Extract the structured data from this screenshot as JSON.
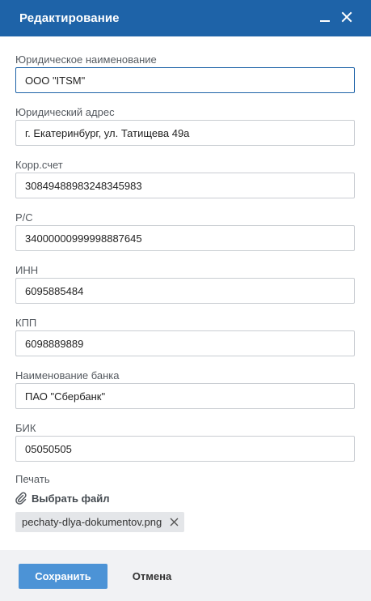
{
  "header": {
    "title": "Редактирование",
    "minimize_icon": "minimize-icon",
    "close_icon": "close-icon"
  },
  "form": {
    "fields": [
      {
        "label": "Юридическое наименование",
        "value": "ООО \"ITSM\""
      },
      {
        "label": "Юридический адрес",
        "value": "г. Екатеринбург, ул. Татищева 49а"
      },
      {
        "label": "Корр.счет",
        "value": "30849488983248345983"
      },
      {
        "label": "Р/С",
        "value": "34000000999998887645"
      },
      {
        "label": "ИНН",
        "value": "6095885484"
      },
      {
        "label": "КПП",
        "value": "6098889889"
      },
      {
        "label": "Наименование банка",
        "value": "ПАО \"Сбербанк\""
      },
      {
        "label": "БИК",
        "value": "05050505"
      }
    ],
    "stamp": {
      "label": "Печать",
      "choose_file_label": "Выбрать файл",
      "attach_icon": "paperclip-icon",
      "file_name": "pechaty-dlya-dokumentov.png",
      "remove_icon": "close-icon"
    }
  },
  "footer": {
    "save_label": "Сохранить",
    "cancel_label": "Отмена"
  },
  "colors": {
    "header_bg": "#1e63a8",
    "primary_button": "#4c93d6",
    "footer_bg": "#f1f2f4",
    "chip_bg": "#e4e6e9"
  }
}
